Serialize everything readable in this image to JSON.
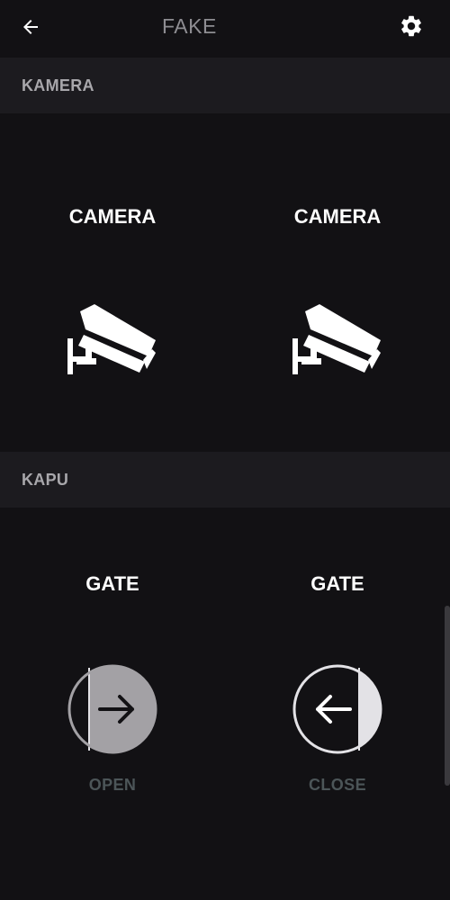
{
  "topbar": {
    "title": "FAKE",
    "back_icon": "arrow-left-icon",
    "settings_icon": "gear-icon"
  },
  "sections": [
    {
      "header": "KAMERA",
      "tiles": [
        {
          "label": "CAMERA",
          "icon": "security-camera-icon"
        },
        {
          "label": "CAMERA",
          "icon": "security-camera-icon"
        }
      ]
    },
    {
      "header": "KAPU",
      "tiles": [
        {
          "label": "GATE",
          "icon": "gate-open-icon",
          "status": "OPEN"
        },
        {
          "label": "GATE",
          "icon": "gate-close-icon",
          "status": "CLOSE"
        }
      ]
    }
  ],
  "colors": {
    "background": "#121114",
    "section_header_bg": "#1c1b1f",
    "status_text": "#4c5558",
    "open_fill": "#a3a1a5",
    "close_fill": "#e3e2e6"
  }
}
